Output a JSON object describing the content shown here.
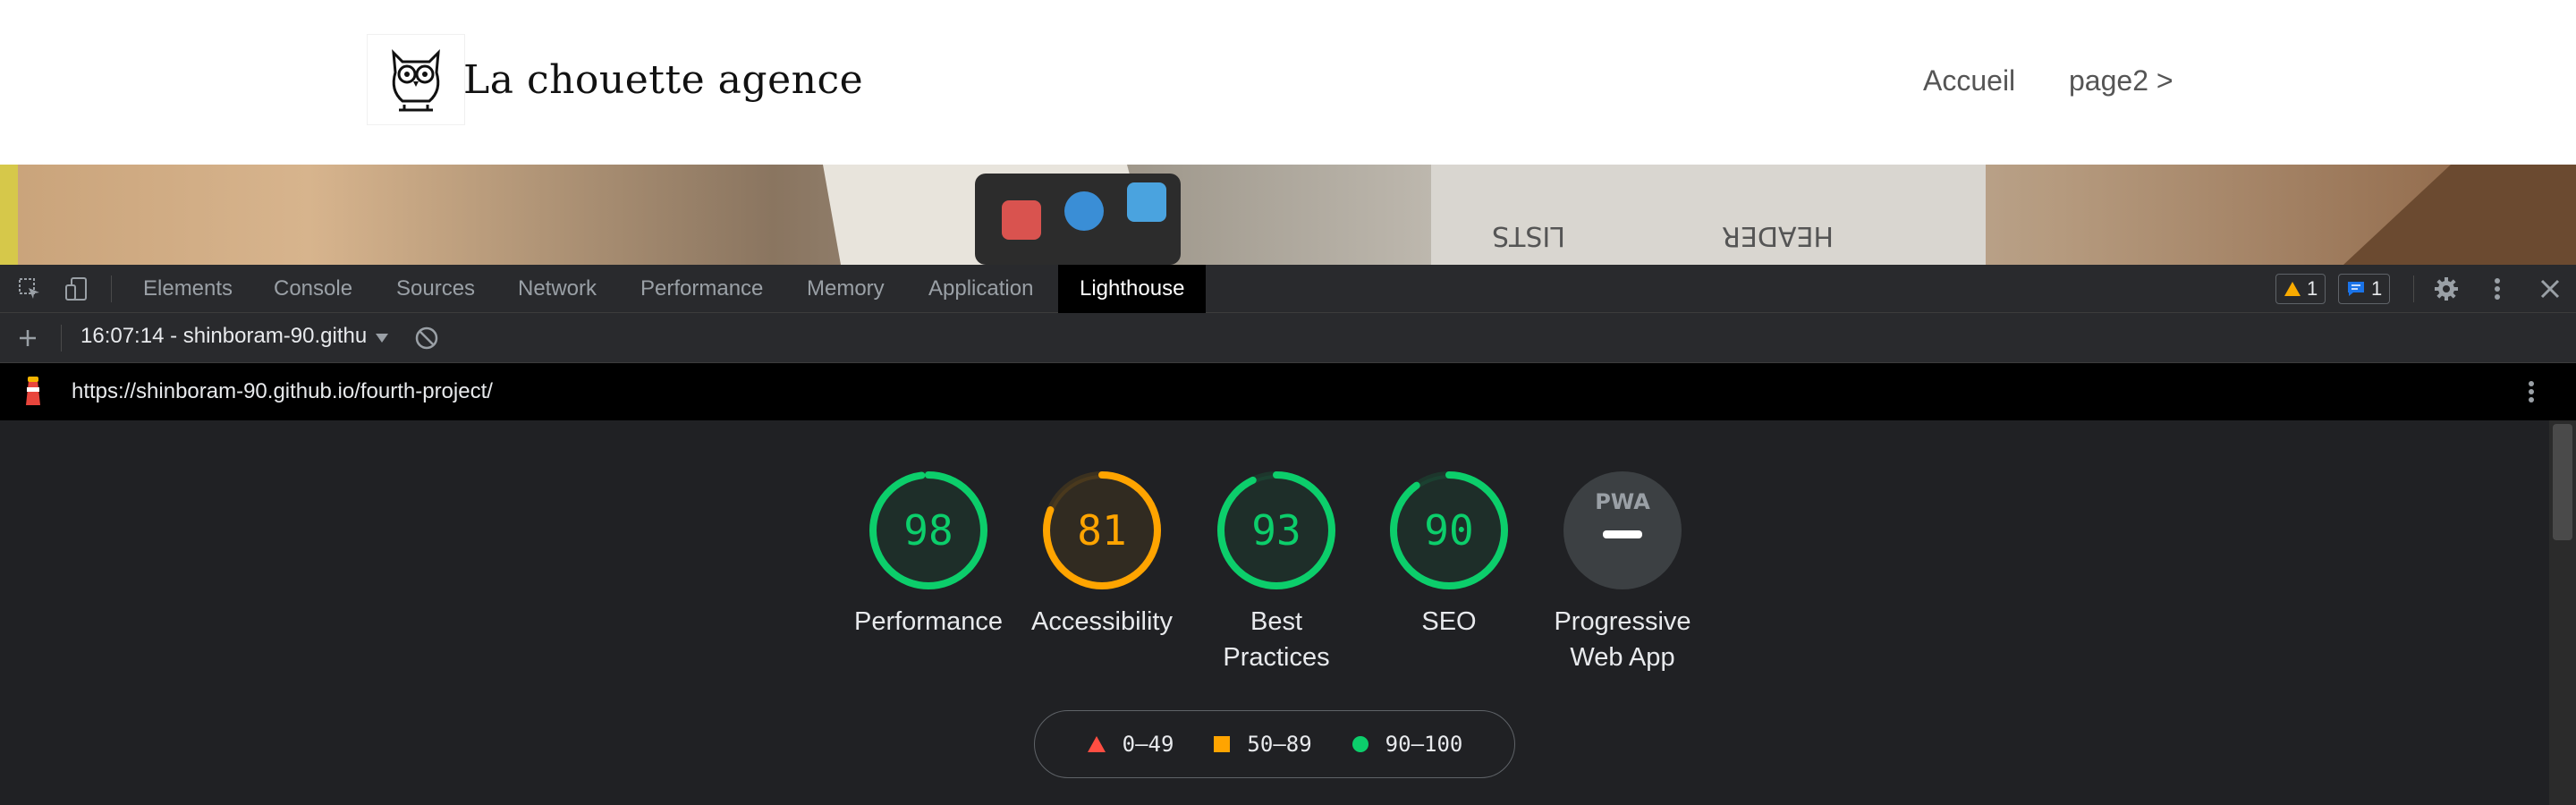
{
  "site": {
    "logo_text": "La chouette agence",
    "nav": [
      {
        "label": "Accueil"
      },
      {
        "label": "page2 >"
      }
    ]
  },
  "devtools": {
    "tabs": [
      "Elements",
      "Console",
      "Sources",
      "Network",
      "Performance",
      "Memory",
      "Application",
      "Lighthouse"
    ],
    "active_tab": "Lighthouse",
    "warning_count": "1",
    "message_count": "1",
    "report_select": "16:07:14 - shinboram-90.githu",
    "url": "https://shinboram-90.github.io/fourth-project/"
  },
  "gauges": [
    {
      "label": "Performance",
      "score": "98",
      "value": 98,
      "color": "#0cce6b"
    },
    {
      "label": "Accessibility",
      "score": "81",
      "value": 81,
      "color": "#ffa400"
    },
    {
      "label": "Best Practices",
      "score": "93",
      "value": 93,
      "color": "#0cce6b"
    },
    {
      "label": "SEO",
      "score": "90",
      "value": 90,
      "color": "#0cce6b"
    },
    {
      "label": "Progressive Web App",
      "badge": "PWA"
    }
  ],
  "legend": [
    {
      "range": "0–49",
      "color": "#ff4e42",
      "icon": "triangle-icon"
    },
    {
      "range": "50–89",
      "color": "#ffa400",
      "icon": "square-icon"
    },
    {
      "range": "90–100",
      "color": "#0cce6b",
      "icon": "circle-icon"
    }
  ]
}
